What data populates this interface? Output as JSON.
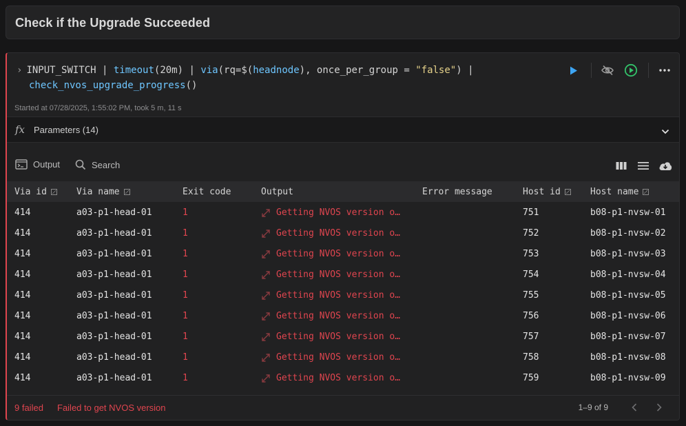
{
  "page": {
    "title": "Check if the Upgrade Succeeded"
  },
  "cell": {
    "code": {
      "line1_prefix": "INPUT_SWITCH | ",
      "fn_timeout": "timeout",
      "timeout_args": "(20m) | ",
      "fn_via": "via",
      "via_args_1": "(rq=$(",
      "arg_headnode": "headnode",
      "via_args_2": "), once_per_group = ",
      "via_str": "\"false\"",
      "via_args_3": ") |",
      "fn_check": "check_nvos_upgrade_progress",
      "check_args": "()"
    },
    "started": "Started at 07/28/2025, 1:55:02 PM, took 5 m, 11 s",
    "parameters_label": "Parameters (14)",
    "output_tab": "Output",
    "search_label": "Search",
    "accent_color": "#e0454f"
  },
  "table": {
    "columns": [
      "Via id",
      "Via name",
      "Exit code",
      "Output",
      "Error message",
      "Host id",
      "Host name"
    ],
    "rows": [
      {
        "via_id": "414",
        "via_name": "a03-p1-head-01",
        "exit_code": "1",
        "output": "Getting NVOS version o…",
        "error": "",
        "host_id": "751",
        "host_name": "b08-p1-nvsw-01"
      },
      {
        "via_id": "414",
        "via_name": "a03-p1-head-01",
        "exit_code": "1",
        "output": "Getting NVOS version o…",
        "error": "",
        "host_id": "752",
        "host_name": "b08-p1-nvsw-02"
      },
      {
        "via_id": "414",
        "via_name": "a03-p1-head-01",
        "exit_code": "1",
        "output": "Getting NVOS version o…",
        "error": "",
        "host_id": "753",
        "host_name": "b08-p1-nvsw-03"
      },
      {
        "via_id": "414",
        "via_name": "a03-p1-head-01",
        "exit_code": "1",
        "output": "Getting NVOS version o…",
        "error": "",
        "host_id": "754",
        "host_name": "b08-p1-nvsw-04"
      },
      {
        "via_id": "414",
        "via_name": "a03-p1-head-01",
        "exit_code": "1",
        "output": "Getting NVOS version o…",
        "error": "",
        "host_id": "755",
        "host_name": "b08-p1-nvsw-05"
      },
      {
        "via_id": "414",
        "via_name": "a03-p1-head-01",
        "exit_code": "1",
        "output": "Getting NVOS version o…",
        "error": "",
        "host_id": "756",
        "host_name": "b08-p1-nvsw-06"
      },
      {
        "via_id": "414",
        "via_name": "a03-p1-head-01",
        "exit_code": "1",
        "output": "Getting NVOS version o…",
        "error": "",
        "host_id": "757",
        "host_name": "b08-p1-nvsw-07"
      },
      {
        "via_id": "414",
        "via_name": "a03-p1-head-01",
        "exit_code": "1",
        "output": "Getting NVOS version o…",
        "error": "",
        "host_id": "758",
        "host_name": "b08-p1-nvsw-08"
      },
      {
        "via_id": "414",
        "via_name": "a03-p1-head-01",
        "exit_code": "1",
        "output": "Getting NVOS version o…",
        "error": "",
        "host_id": "759",
        "host_name": "b08-p1-nvsw-09"
      }
    ]
  },
  "footer": {
    "failed": "9 failed",
    "message": "Failed to get NVOS version",
    "pagination": "1–9 of 9"
  },
  "icons": {
    "run": "play-icon",
    "hide": "eye-off-icon",
    "run_all": "play-circle-icon",
    "more": "more-icon",
    "fx": "function-icon",
    "chevron": "chevron-down-icon",
    "terminal": "terminal-icon",
    "search": "search-icon",
    "columns": "columns-icon",
    "density": "density-icon",
    "download": "cloud-download-icon",
    "expand": "expand-icon",
    "prev": "chevron-left-icon",
    "next": "chevron-right-icon"
  }
}
